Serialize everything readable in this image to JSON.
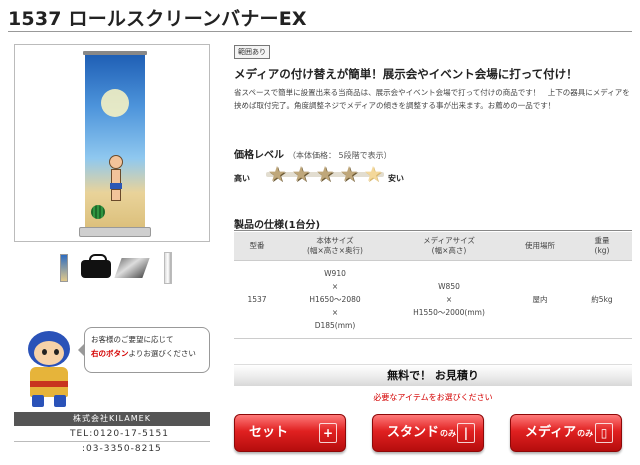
{
  "page": {
    "title": "1537 ロールスクリーンバナーEX"
  },
  "product": {
    "badge": "範囲あり",
    "headline": "メディアの付け替えが簡単！展示会やイベント会場に打って付け！",
    "description": "省スペースで簡単に設置出来る当商品は、展示会やイベント会場で打って付けの商品です！　上下の器具にメディアを挟めば取付完了。角度調整ネジでメディアの傾きを調整する事が出来ます。お薦めの一品です！"
  },
  "price": {
    "heading": "価格レベル",
    "note": "（本体価格： 5段階で表示）",
    "low_label": "高い",
    "high_label": "安い",
    "level": 4,
    "max_level": 5
  },
  "spec": {
    "heading": "製品の仕様(1台分)",
    "columns": [
      "型番",
      "本体サイズ\n(幅×高さ×奥行)",
      "メディアサイズ\n(幅×高さ)",
      "使用場所",
      "重量\n(kg)"
    ],
    "rows": [
      {
        "model": "1537",
        "body_size": "W910\n×\nH1650～2080\n×\nD185(mm)",
        "media_size": "W850\n×\nH1550～2000(mm)",
        "location": "屋内",
        "weight": "約5kg"
      }
    ]
  },
  "help": {
    "line1": "お客様のご要望に応じて",
    "line2_red": "右のボタン",
    "line2_rest": "よりお選びください"
  },
  "company": {
    "name": "株式会社KILAMEK",
    "tel": "TEL:0120-17-5151",
    "fax": ":03-3350-8215"
  },
  "estimate": {
    "title": "無料で！ お見積り",
    "note": "必要なアイテムをお選びください"
  },
  "buttons": {
    "set": "セット",
    "stand_main": "スタンド",
    "stand_sub": "のみ",
    "media_main": "メディア",
    "media_sub": "のみ"
  },
  "colors": {
    "accent_red": "#e02020",
    "warning_red": "#d40000"
  }
}
